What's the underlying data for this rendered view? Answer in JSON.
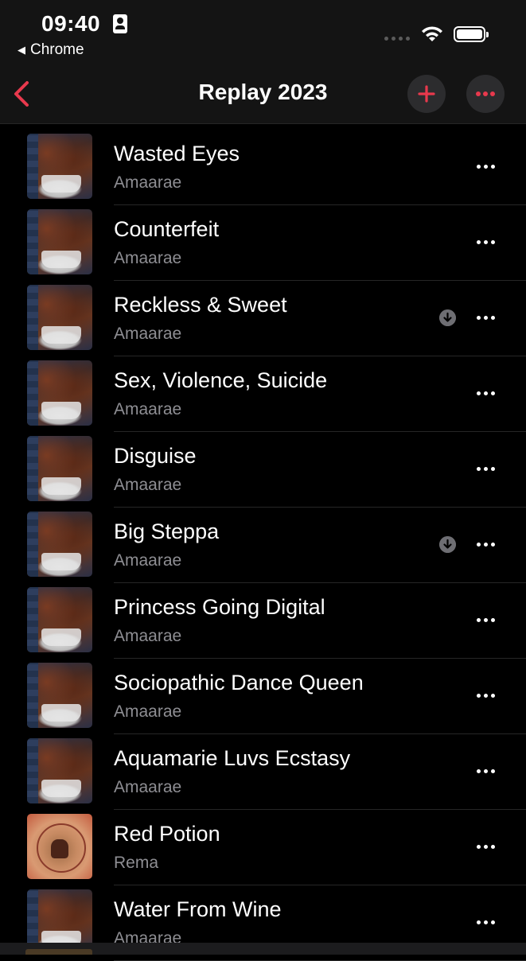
{
  "status": {
    "time": "09:40",
    "back_app": "Chrome"
  },
  "nav": {
    "title": "Replay 2023",
    "accent_color": "#e8394d"
  },
  "tracks": [
    {
      "title": "Wasted Eyes",
      "artist": "Amaarae",
      "art": "amaarae",
      "downloaded": false
    },
    {
      "title": "Counterfeit",
      "artist": "Amaarae",
      "art": "amaarae",
      "downloaded": false
    },
    {
      "title": "Reckless & Sweet",
      "artist": "Amaarae",
      "art": "amaarae",
      "downloaded": true
    },
    {
      "title": "Sex, Violence, Suicide",
      "artist": "Amaarae",
      "art": "amaarae",
      "downloaded": false
    },
    {
      "title": "Disguise",
      "artist": "Amaarae",
      "art": "amaarae",
      "downloaded": false
    },
    {
      "title": "Big Steppa",
      "artist": "Amaarae",
      "art": "amaarae",
      "downloaded": true
    },
    {
      "title": "Princess Going Digital",
      "artist": "Amaarae",
      "art": "amaarae",
      "downloaded": false
    },
    {
      "title": "Sociopathic Dance Queen",
      "artist": "Amaarae",
      "art": "amaarae",
      "downloaded": false
    },
    {
      "title": "Aquamarie Luvs Ecstasy",
      "artist": "Amaarae",
      "art": "amaarae",
      "downloaded": false
    },
    {
      "title": "Red Potion",
      "artist": "Rema",
      "art": "rema",
      "downloaded": false
    },
    {
      "title": "Water From Wine",
      "artist": "Amaarae",
      "art": "amaarae",
      "downloaded": false
    }
  ]
}
